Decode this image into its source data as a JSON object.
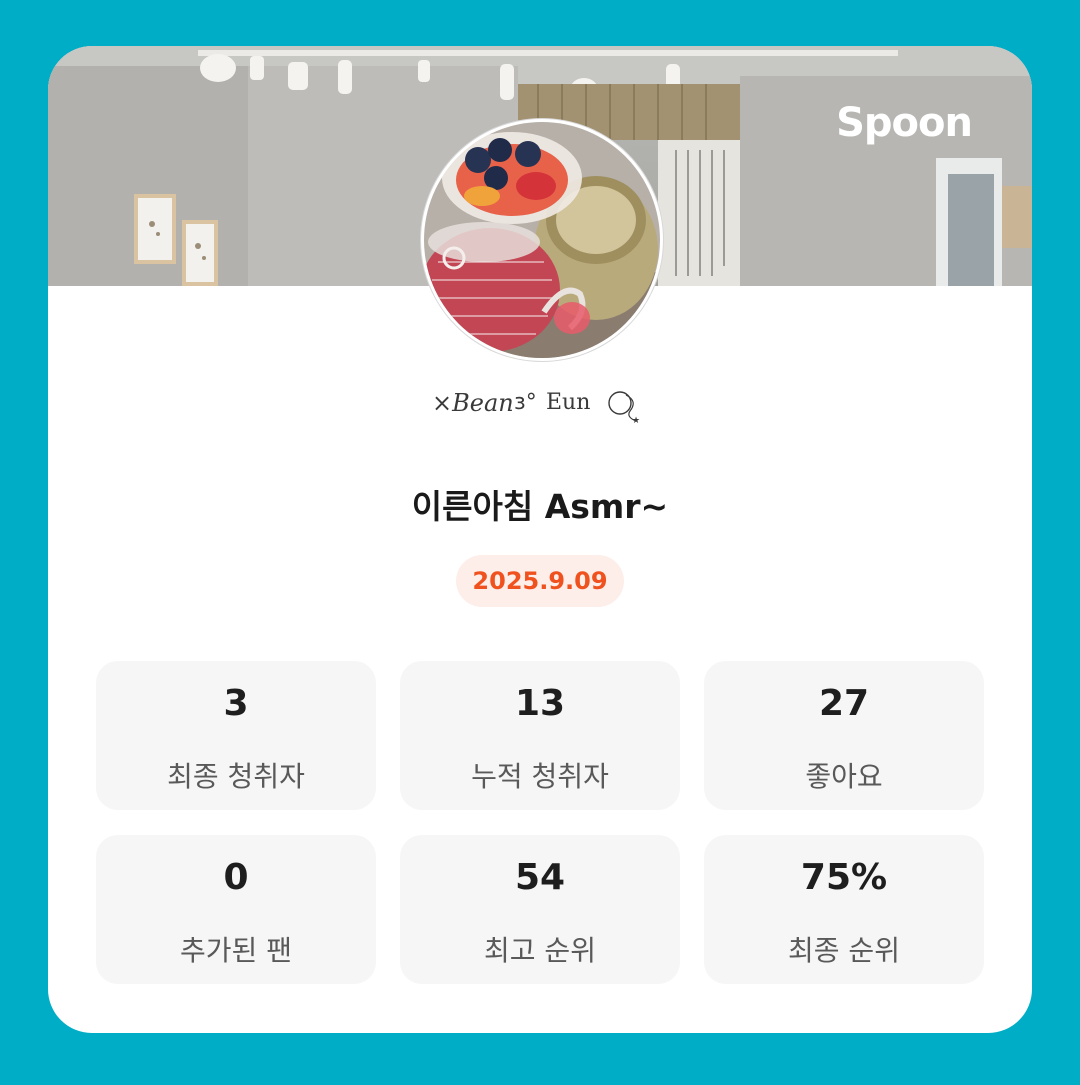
{
  "brand": {
    "logo_text": "Spoon"
  },
  "profile": {
    "avatar_description": "avatar-photo",
    "signature_text": "Bean Eun"
  },
  "broadcast": {
    "title": "이른아침 Asmr~",
    "date": "2025.9.09"
  },
  "stats": [
    {
      "value": "3",
      "label": "최종 청취자"
    },
    {
      "value": "13",
      "label": "누적 청취자"
    },
    {
      "value": "27",
      "label": "좋아요"
    },
    {
      "value": "0",
      "label": "추가된 팬"
    },
    {
      "value": "54",
      "label": "최고 순위"
    },
    {
      "value": "75%",
      "label": "최종 순위"
    }
  ],
  "colors": {
    "background": "#00adc6",
    "card": "#ffffff",
    "date_text": "#f0521f",
    "date_pill": "#fdeee9",
    "stat_tile": "#f6f6f6"
  }
}
